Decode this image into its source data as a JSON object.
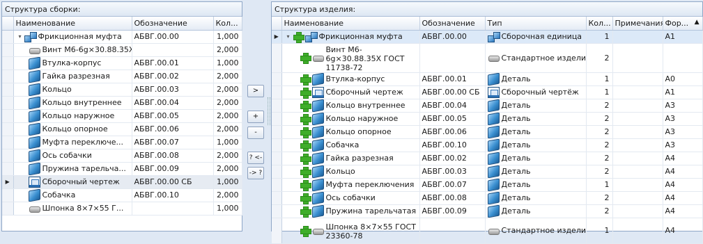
{
  "left": {
    "title": "Структура сборки:",
    "columns": [
      "Наименование",
      "Обозначение",
      "Кол..."
    ],
    "rows": [
      {
        "name": "Фрикционная муфта",
        "code": "АБВГ.00.00",
        "qty": "1,000",
        "icon": "assembly-icon",
        "level": 0,
        "expander": "▾"
      },
      {
        "name": "Винт М6-6g×30.88.35Х...",
        "code": "",
        "qty": "2,000",
        "icon": "standard-part-icon",
        "level": 1
      },
      {
        "name": "Втулка-корпус",
        "code": "АБВГ.00.01",
        "qty": "1,000",
        "icon": "part-icon",
        "level": 1
      },
      {
        "name": "Гайка разрезная",
        "code": "АБВГ.00.02",
        "qty": "2,000",
        "icon": "part-icon",
        "level": 1
      },
      {
        "name": "Кольцо",
        "code": "АБВГ.00.03",
        "qty": "2,000",
        "icon": "part-icon",
        "level": 1
      },
      {
        "name": "Кольцо внутреннее",
        "code": "АБВГ.00.04",
        "qty": "2,000",
        "icon": "part-icon",
        "level": 1
      },
      {
        "name": "Кольцо наружное",
        "code": "АБВГ.00.05",
        "qty": "2,000",
        "icon": "part-icon",
        "level": 1
      },
      {
        "name": "Кольцо опорное",
        "code": "АБВГ.00.06",
        "qty": "2,000",
        "icon": "part-icon",
        "level": 1
      },
      {
        "name": "Муфта переключе...",
        "code": "АБВГ.00.07",
        "qty": "1,000",
        "icon": "part-icon",
        "level": 1
      },
      {
        "name": "Ось собачки",
        "code": "АБВГ.00.08",
        "qty": "2,000",
        "icon": "part-icon",
        "level": 1
      },
      {
        "name": "Пружина тарельча...",
        "code": "АБВГ.00.09",
        "qty": "2,000",
        "icon": "part-icon",
        "level": 1
      },
      {
        "name": "Сборочный чертеж",
        "code": "АБВГ.00.00 СБ",
        "qty": "1,000",
        "icon": "drawing-icon",
        "level": 1,
        "selected": true,
        "marker": "▶"
      },
      {
        "name": "Собачка",
        "code": "АБВГ.00.10",
        "qty": "2,000",
        "icon": "part-icon",
        "level": 1
      },
      {
        "name": "Шпонка 8×7×55 Г...",
        "code": "",
        "qty": "1,000",
        "icon": "standard-part-icon",
        "level": 1
      }
    ]
  },
  "buttons": {
    "move_right": ">",
    "add": "+",
    "remove": "-",
    "query_left": "? <-",
    "query_right": "-> ?"
  },
  "right": {
    "title": "Структура изделия:",
    "columns": [
      "Наименование",
      "Обозначение",
      "Тип",
      "Кол...",
      "Примечания",
      "Фор..."
    ],
    "sort_indicator": "▲",
    "rows": [
      {
        "name": "Фрикционная муфта",
        "code": "АБВГ.00.00",
        "type": "Сборочная единица",
        "typeicon": "assembly-icon",
        "qty": "1",
        "note": "",
        "fmt": "А1",
        "icon": "assembly-icon",
        "level": 0,
        "marker": "▶",
        "expander": "▾",
        "highlight": true
      },
      {
        "name": "Винт М6-6g×30.88.35Х ГОСТ 11738-72",
        "code": "",
        "type": "Стандартное изделие",
        "typeicon": "standard-part-icon",
        "qty": "2",
        "note": "",
        "fmt": "",
        "icon": "standard-part-icon",
        "level": 1,
        "tall": true
      },
      {
        "name": "Втулка-корпус",
        "code": "АБВГ.00.01",
        "type": "Деталь",
        "typeicon": "part-icon",
        "qty": "1",
        "note": "",
        "fmt": "А0",
        "icon": "part-icon",
        "level": 1
      },
      {
        "name": "Сборочный чертеж",
        "code": "АБВГ.00.00 СБ",
        "type": "Сборочный чертёж",
        "typeicon": "drawing-icon",
        "qty": "1",
        "note": "",
        "fmt": "А1",
        "icon": "drawing-icon",
        "level": 1
      },
      {
        "name": "Кольцо внутреннее",
        "code": "АБВГ.00.04",
        "type": "Деталь",
        "typeicon": "part-icon",
        "qty": "2",
        "note": "",
        "fmt": "А3",
        "icon": "part-icon",
        "level": 1
      },
      {
        "name": "Кольцо наружное",
        "code": "АБВГ.00.05",
        "type": "Деталь",
        "typeicon": "part-icon",
        "qty": "2",
        "note": "",
        "fmt": "А3",
        "icon": "part-icon",
        "level": 1
      },
      {
        "name": "Кольцо опорное",
        "code": "АБВГ.00.06",
        "type": "Деталь",
        "typeicon": "part-icon",
        "qty": "2",
        "note": "",
        "fmt": "А3",
        "icon": "part-icon",
        "level": 1
      },
      {
        "name": "Собачка",
        "code": "АБВГ.00.10",
        "type": "Деталь",
        "typeicon": "part-icon",
        "qty": "2",
        "note": "",
        "fmt": "А3",
        "icon": "part-icon",
        "level": 1
      },
      {
        "name": "Гайка разрезная",
        "code": "АБВГ.00.02",
        "type": "Деталь",
        "typeicon": "part-icon",
        "qty": "2",
        "note": "",
        "fmt": "А4",
        "icon": "part-icon",
        "level": 1
      },
      {
        "name": "Кольцо",
        "code": "АБВГ.00.03",
        "type": "Деталь",
        "typeicon": "part-icon",
        "qty": "2",
        "note": "",
        "fmt": "А4",
        "icon": "part-icon",
        "level": 1
      },
      {
        "name": "Муфта переключения",
        "code": "АБВГ.00.07",
        "type": "Деталь",
        "typeicon": "part-icon",
        "qty": "1",
        "note": "",
        "fmt": "А4",
        "icon": "part-icon",
        "level": 1
      },
      {
        "name": "Ось собачки",
        "code": "АБВГ.00.08",
        "type": "Деталь",
        "typeicon": "part-icon",
        "qty": "2",
        "note": "",
        "fmt": "А4",
        "icon": "part-icon",
        "level": 1
      },
      {
        "name": "Пружина тарельчатая",
        "code": "АБВГ.00.09",
        "type": "Деталь",
        "typeicon": "part-icon",
        "qty": "2",
        "note": "",
        "fmt": "А4",
        "icon": "part-icon",
        "level": 1
      },
      {
        "name": "Шпонка 8×7×55 ГОСТ 23360-78",
        "code": "",
        "type": "Стандартное изделие",
        "typeicon": "standard-part-icon",
        "qty": "1",
        "note": "",
        "fmt": "А4",
        "icon": "standard-part-icon",
        "level": 1,
        "tall": true
      }
    ]
  }
}
